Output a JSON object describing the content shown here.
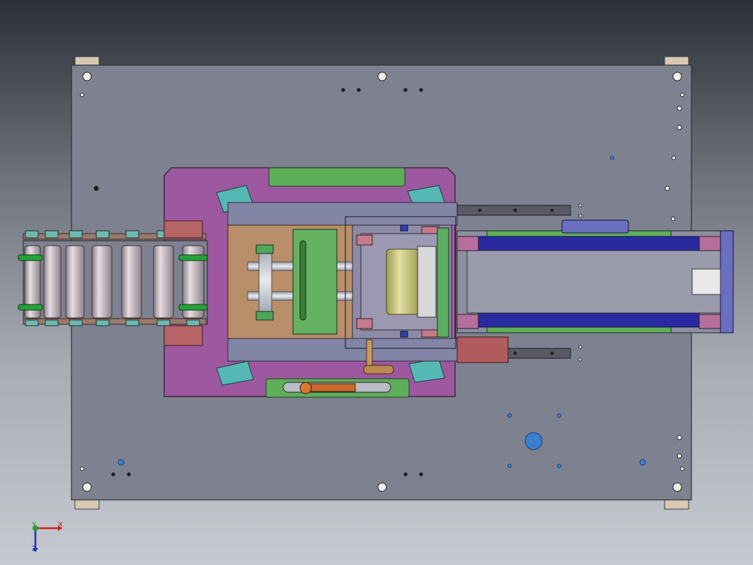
{
  "viewport": {
    "colors": {
      "bg_top": "#2c3036",
      "bg_bottom": "#c6cad1",
      "plate": "#7e818f"
    },
    "triad": {
      "x_label": "X",
      "y_label": "Y",
      "z_label": "Z",
      "x_color": "#d02020",
      "y_color": "#20a020",
      "z_color": "#2030c0"
    }
  }
}
